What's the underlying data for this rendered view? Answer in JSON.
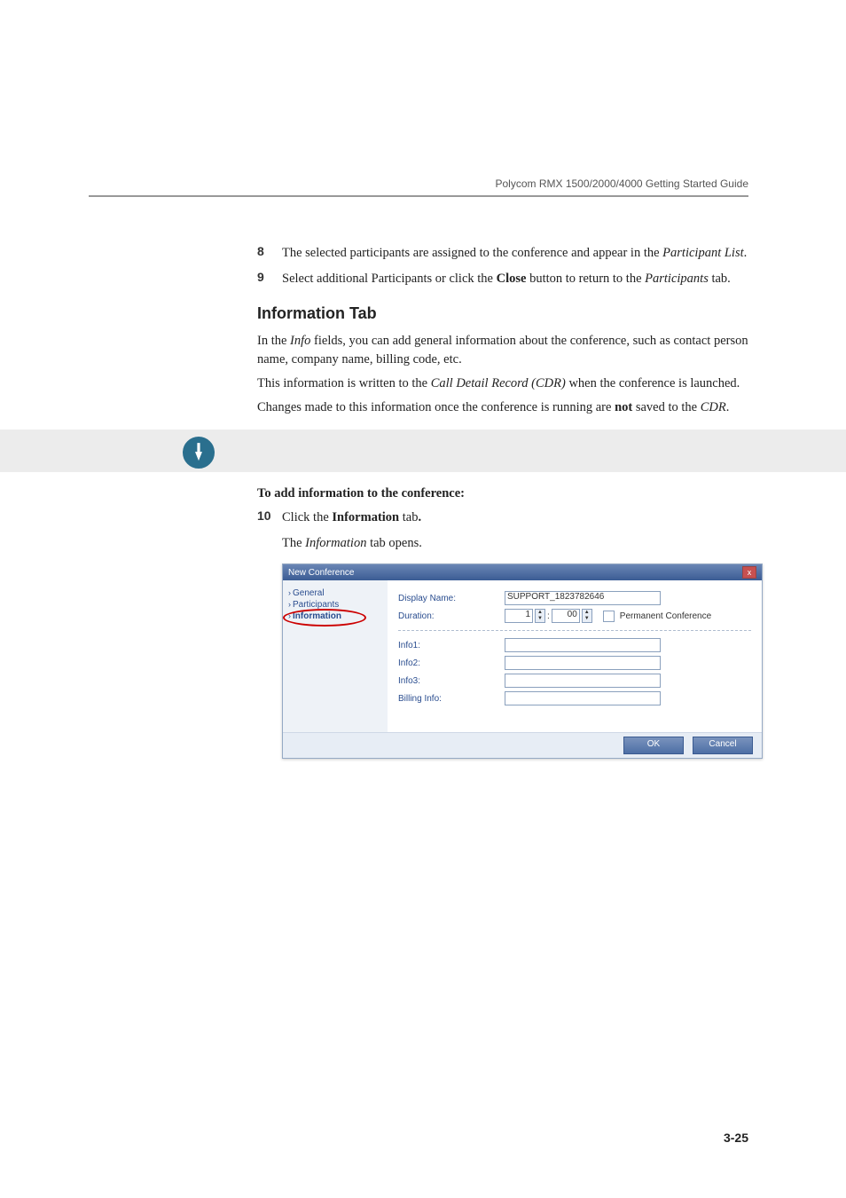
{
  "header": {
    "guide_title": "Polycom RMX 1500/2000/4000 Getting Started Guide"
  },
  "steps": {
    "s8": {
      "num": "8",
      "text_a": "The selected participants are assigned to the conference and appear in the ",
      "text_b": "Participant List",
      "text_c": "."
    },
    "s9": {
      "num": "9",
      "text_a": "Select additional Participants or click the ",
      "text_b": "Close",
      "text_c": " button to return to the ",
      "text_d": "Participants",
      "text_e": " tab."
    },
    "s10": {
      "num": "10",
      "text_a": "Click the ",
      "text_b": "Information",
      "text_c": " tab",
      "text_d": "."
    }
  },
  "section": {
    "heading": "Information Tab",
    "p1a": "In the ",
    "p1b": "Info",
    "p1c": " fields, you can add general information about the conference, such as contact person name, company name, billing code, etc.",
    "p2a": "This information is written to the ",
    "p2b": "Call Detail Record (CDR)",
    "p2c": " when the conference is launched.",
    "p3a": "Changes made to this information once the conference is running are ",
    "p3b": "not",
    "p3c": " saved to the ",
    "p3d": "CDR",
    "p3e": "."
  },
  "procedure": {
    "title": "To add information to the conference:",
    "caption_a": "The ",
    "caption_b": "Information",
    "caption_c": " tab opens."
  },
  "dialog": {
    "title": "New Conference",
    "close_glyph": "x",
    "nav": {
      "general": "General",
      "participants": "Participants",
      "information": "Information"
    },
    "labels": {
      "display_name": "Display Name:",
      "duration": "Duration:",
      "info1": "Info1:",
      "info2": "Info2:",
      "info3": "Info3:",
      "billing": "Billing Info:",
      "permanent": "Permanent Conference"
    },
    "values": {
      "display_name": "SUPPORT_1823782646",
      "dur_h": "1",
      "dur_sep": ":",
      "dur_m": "00",
      "info1": "",
      "info2": "",
      "info3": "",
      "billing": ""
    },
    "buttons": {
      "ok": "OK",
      "cancel": "Cancel"
    }
  },
  "page_number": "3-25"
}
